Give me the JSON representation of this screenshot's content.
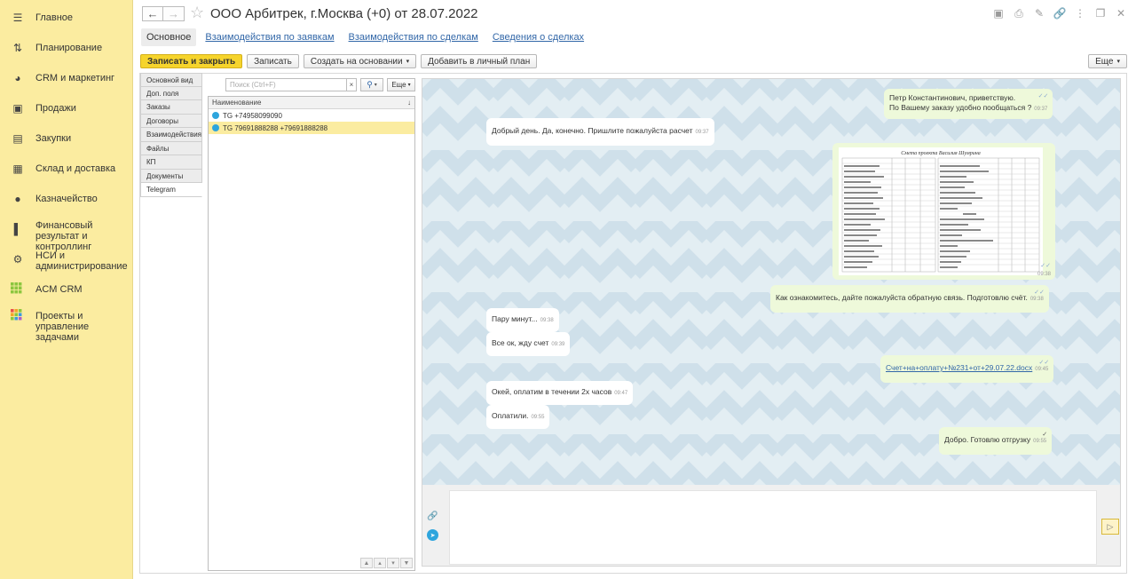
{
  "sidebar": {
    "items": [
      {
        "label": "Главное",
        "icon": "menu-icon"
      },
      {
        "label": "Планирование",
        "icon": "planning-icon"
      },
      {
        "label": "CRM и маркетинг",
        "icon": "pie-chart-icon"
      },
      {
        "label": "Продажи",
        "icon": "bag-icon"
      },
      {
        "label": "Закупки",
        "icon": "cart-icon"
      },
      {
        "label": "Склад и доставка",
        "icon": "warehouse-icon"
      },
      {
        "label": "Казначейство",
        "icon": "coin-icon"
      },
      {
        "label": "Финансовый результат и контроллинг",
        "icon": "bar-chart-icon"
      },
      {
        "label": "НСИ и администрирование",
        "icon": "gear-icon"
      },
      {
        "label": "ACM CRM",
        "icon": "grid-green-icon"
      },
      {
        "label": "Проекты и управление задачами",
        "icon": "grid-multicolor-icon"
      }
    ]
  },
  "header": {
    "title": "ООО Арбитрек, г.Москва (+0) от 28.07.2022"
  },
  "tabs": [
    "Основное",
    "Взаимодействия по заявкам",
    "Взаимодействия по сделкам",
    "Сведения о сделках"
  ],
  "toolbar": {
    "save_close": "Записать и закрыть",
    "save": "Записать",
    "create_based": "Создать на основании",
    "add_plan": "Добавить в личный план",
    "more": "Еще"
  },
  "vtabs": [
    "Основной вид",
    "Доп. поля",
    "Заказы",
    "Договоры",
    "Взаимодействия",
    "Файлы",
    "КП",
    "Документы",
    "Telegram"
  ],
  "contacts": {
    "search_placeholder": "Поиск (Ctrl+F)",
    "more": "Еще",
    "column": "Наименование",
    "rows": [
      "TG  +74958099090",
      "TG 79691888288 +79691888288"
    ]
  },
  "chat": {
    "messages": [
      {
        "dir": "out",
        "lines": [
          "Петр Константинович, приветствую.",
          "По Вашему заказу удобно пообщаться ?"
        ],
        "time": "09:37"
      },
      {
        "dir": "in",
        "lines": [
          "Добрый день. Да, конечно. Пришлите пожалуйста расчет"
        ],
        "time": "09:37"
      },
      {
        "dir": "out",
        "lines": [
          "Как ознакомитесь, дайте пожалуйста обратную связь. Подготовлю счёт."
        ],
        "time": "09:38"
      },
      {
        "dir": "in",
        "lines": [
          "Пару минут..."
        ],
        "time": "09:38"
      },
      {
        "dir": "in",
        "lines": [
          "Все ок, жду счет"
        ],
        "time": "09:39"
      },
      {
        "dir": "out",
        "lines": [
          "Счет+на+оплату+№231+от+29.07.22.docx"
        ],
        "time": "09:45"
      },
      {
        "dir": "in",
        "lines": [
          "Окей, оплатим в течении 2х часов"
        ],
        "time": "09:47"
      },
      {
        "dir": "in",
        "lines": [
          "Оплатили."
        ],
        "time": "09:55"
      },
      {
        "dir": "out",
        "lines": [
          "Добро. Готовлю отгрузку"
        ],
        "time": "09:55"
      }
    ],
    "image_time": "09:38",
    "image_title": "Смета проекта Василия Шумрина"
  }
}
